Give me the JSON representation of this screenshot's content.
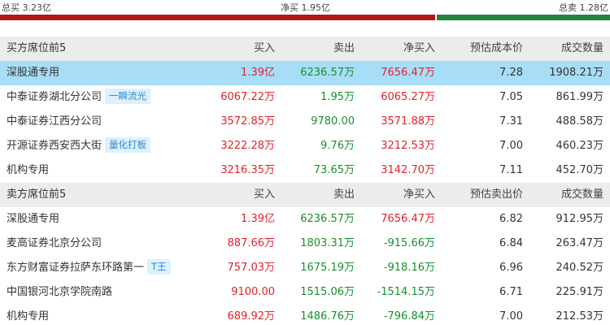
{
  "summary": {
    "total_buy": "总买 3.23亿",
    "net_buy": "净买 1.95亿",
    "total_sell": "总卖 1.28亿",
    "colors": {
      "buy": "#b01717",
      "sell": "#26823a"
    }
  },
  "buy_table": {
    "headers": [
      "买方席位前5",
      "买入",
      "卖出",
      "净买入",
      "预估成本价",
      "成交数量"
    ],
    "rows": [
      {
        "name": "深股通专用",
        "tag": "",
        "buy": "1.39亿",
        "sell": "6236.57万",
        "net": "7656.47万",
        "price": "7.28",
        "volume": "1908.21万"
      },
      {
        "name": "中泰证券湖北分公司",
        "tag": "一瞬流光",
        "buy": "6067.22万",
        "sell": "1.95万",
        "net": "6065.27万",
        "price": "7.05",
        "volume": "861.99万"
      },
      {
        "name": "中泰证券江西分公司",
        "tag": "",
        "buy": "3572.85万",
        "sell": "9780.00",
        "net": "3571.88万",
        "price": "7.31",
        "volume": "488.58万"
      },
      {
        "name": "开源证券西安西大街",
        "tag": "量化打板",
        "buy": "3222.28万",
        "sell": "9.76万",
        "net": "3212.53万",
        "price": "7.00",
        "volume": "460.23万"
      },
      {
        "name": "机构专用",
        "tag": "",
        "buy": "3216.35万",
        "sell": "73.65万",
        "net": "3142.70万",
        "price": "7.11",
        "volume": "452.70万"
      }
    ]
  },
  "sell_table": {
    "headers": [
      "卖方席位前5",
      "买入",
      "卖出",
      "净买入",
      "预估卖出价",
      "成交数量"
    ],
    "rows": [
      {
        "name": "深股通专用",
        "tag": "",
        "buy": "1.39亿",
        "sell": "6236.57万",
        "net": "7656.47万",
        "price": "6.82",
        "volume": "912.95万"
      },
      {
        "name": "麦高证券北京分公司",
        "tag": "",
        "buy": "887.66万",
        "sell": "1803.31万",
        "net": "-915.66万",
        "price": "6.84",
        "volume": "263.47万"
      },
      {
        "name": "东方财富证券拉萨东环路第一",
        "tag": "T王",
        "buy": "757.03万",
        "sell": "1675.19万",
        "net": "-918.16万",
        "price": "6.96",
        "volume": "240.52万"
      },
      {
        "name": "中国银河北京学院南路",
        "tag": "",
        "buy": "9100.00",
        "sell": "1515.06万",
        "net": "-1514.15万",
        "price": "6.71",
        "volume": "225.91万"
      },
      {
        "name": "机构专用",
        "tag": "",
        "buy": "689.92万",
        "sell": "1486.76万",
        "net": "-796.84万",
        "price": "7.00",
        "volume": "212.53万"
      }
    ]
  }
}
